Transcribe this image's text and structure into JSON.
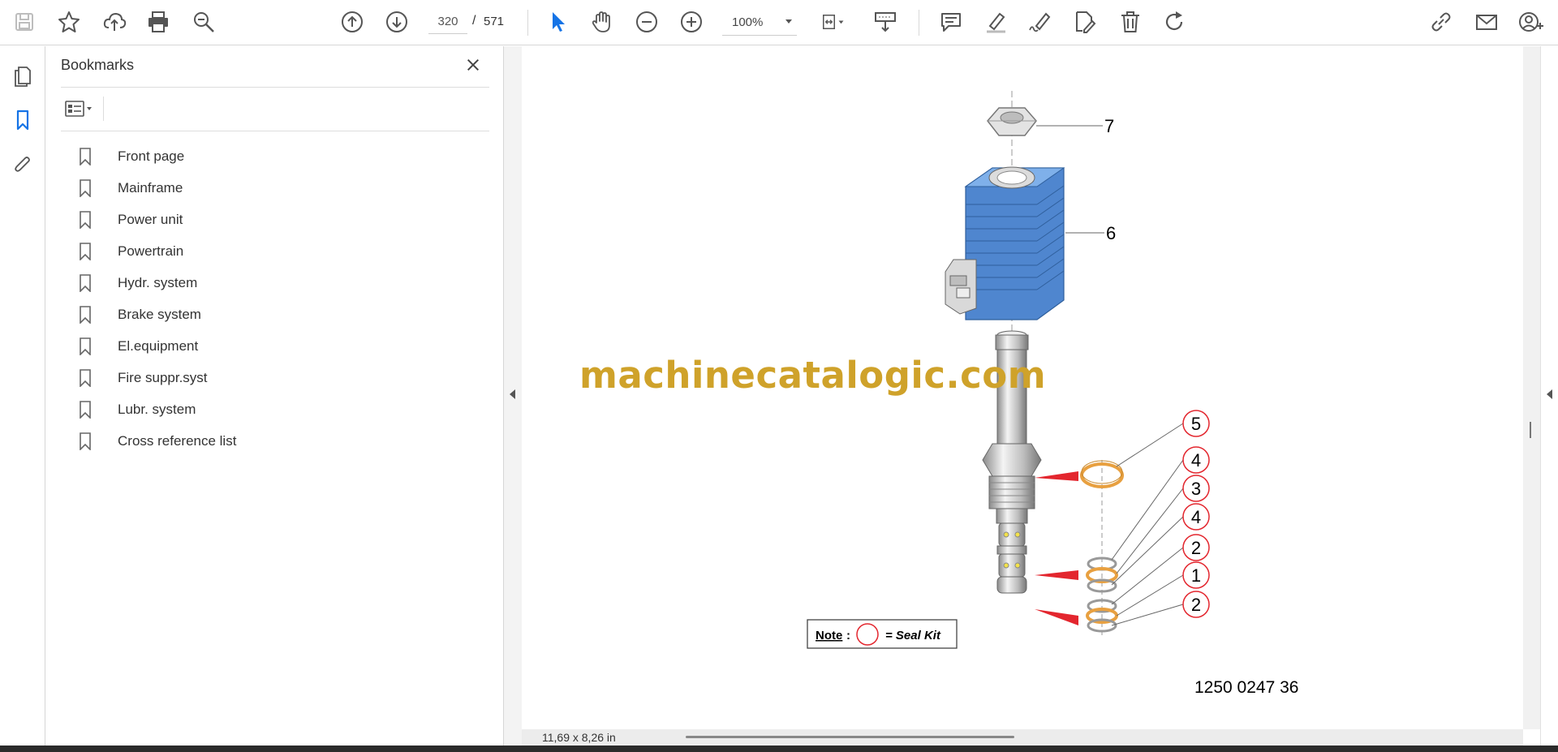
{
  "toolbar": {
    "left_icons": [
      "save-icon",
      "star-icon",
      "upload-icon",
      "print-icon",
      "find-icon"
    ],
    "nav_icons": [
      "page-up-icon",
      "page-down-icon"
    ],
    "page_current": "320",
    "page_separator": "/",
    "page_total": "571",
    "tool_icons": [
      "select-arrow-icon",
      "hand-icon",
      "zoom-out-icon",
      "zoom-in-icon"
    ],
    "zoom_value": "100%",
    "view_icons": [
      "fit-page-icon",
      "scroll-mode-icon"
    ],
    "annotate_icons": [
      "comment-icon",
      "highlight-icon",
      "sign-icon",
      "edit-pdf-icon",
      "delete-icon",
      "rotate-icon"
    ],
    "right_icons": [
      "share-link-icon",
      "email-icon",
      "add-user-icon"
    ]
  },
  "left_rail": {
    "icons": [
      "page-thumbnails-icon",
      "bookmarks-icon",
      "attachments-icon"
    ]
  },
  "bookmarks": {
    "title": "Bookmarks",
    "items": [
      {
        "label": "Front page"
      },
      {
        "label": "Mainframe"
      },
      {
        "label": "Power unit"
      },
      {
        "label": "Powertrain"
      },
      {
        "label": "Hydr. system"
      },
      {
        "label": "Brake system"
      },
      {
        "label": "El.equipment"
      },
      {
        "label": "Fire suppr.syst"
      },
      {
        "label": "Lubr. system"
      },
      {
        "label": "Cross reference list"
      }
    ]
  },
  "document": {
    "watermark": "machinecatalogic.com",
    "callouts": [
      "7",
      "6",
      "5",
      "4",
      "3",
      "4",
      "2",
      "1",
      "2"
    ],
    "note_label": "Note",
    "note_colon": ":",
    "note_text": "= Seal Kit",
    "part_number": "1250 0247 36",
    "colors": {
      "coil_blue": "#5b8fd6",
      "seal_orange": "#e8a040",
      "callout_red": "#e3262e",
      "watermark_gold": "#cfa22a"
    }
  },
  "status": {
    "page_size": "11,69 x 8,26 in"
  }
}
